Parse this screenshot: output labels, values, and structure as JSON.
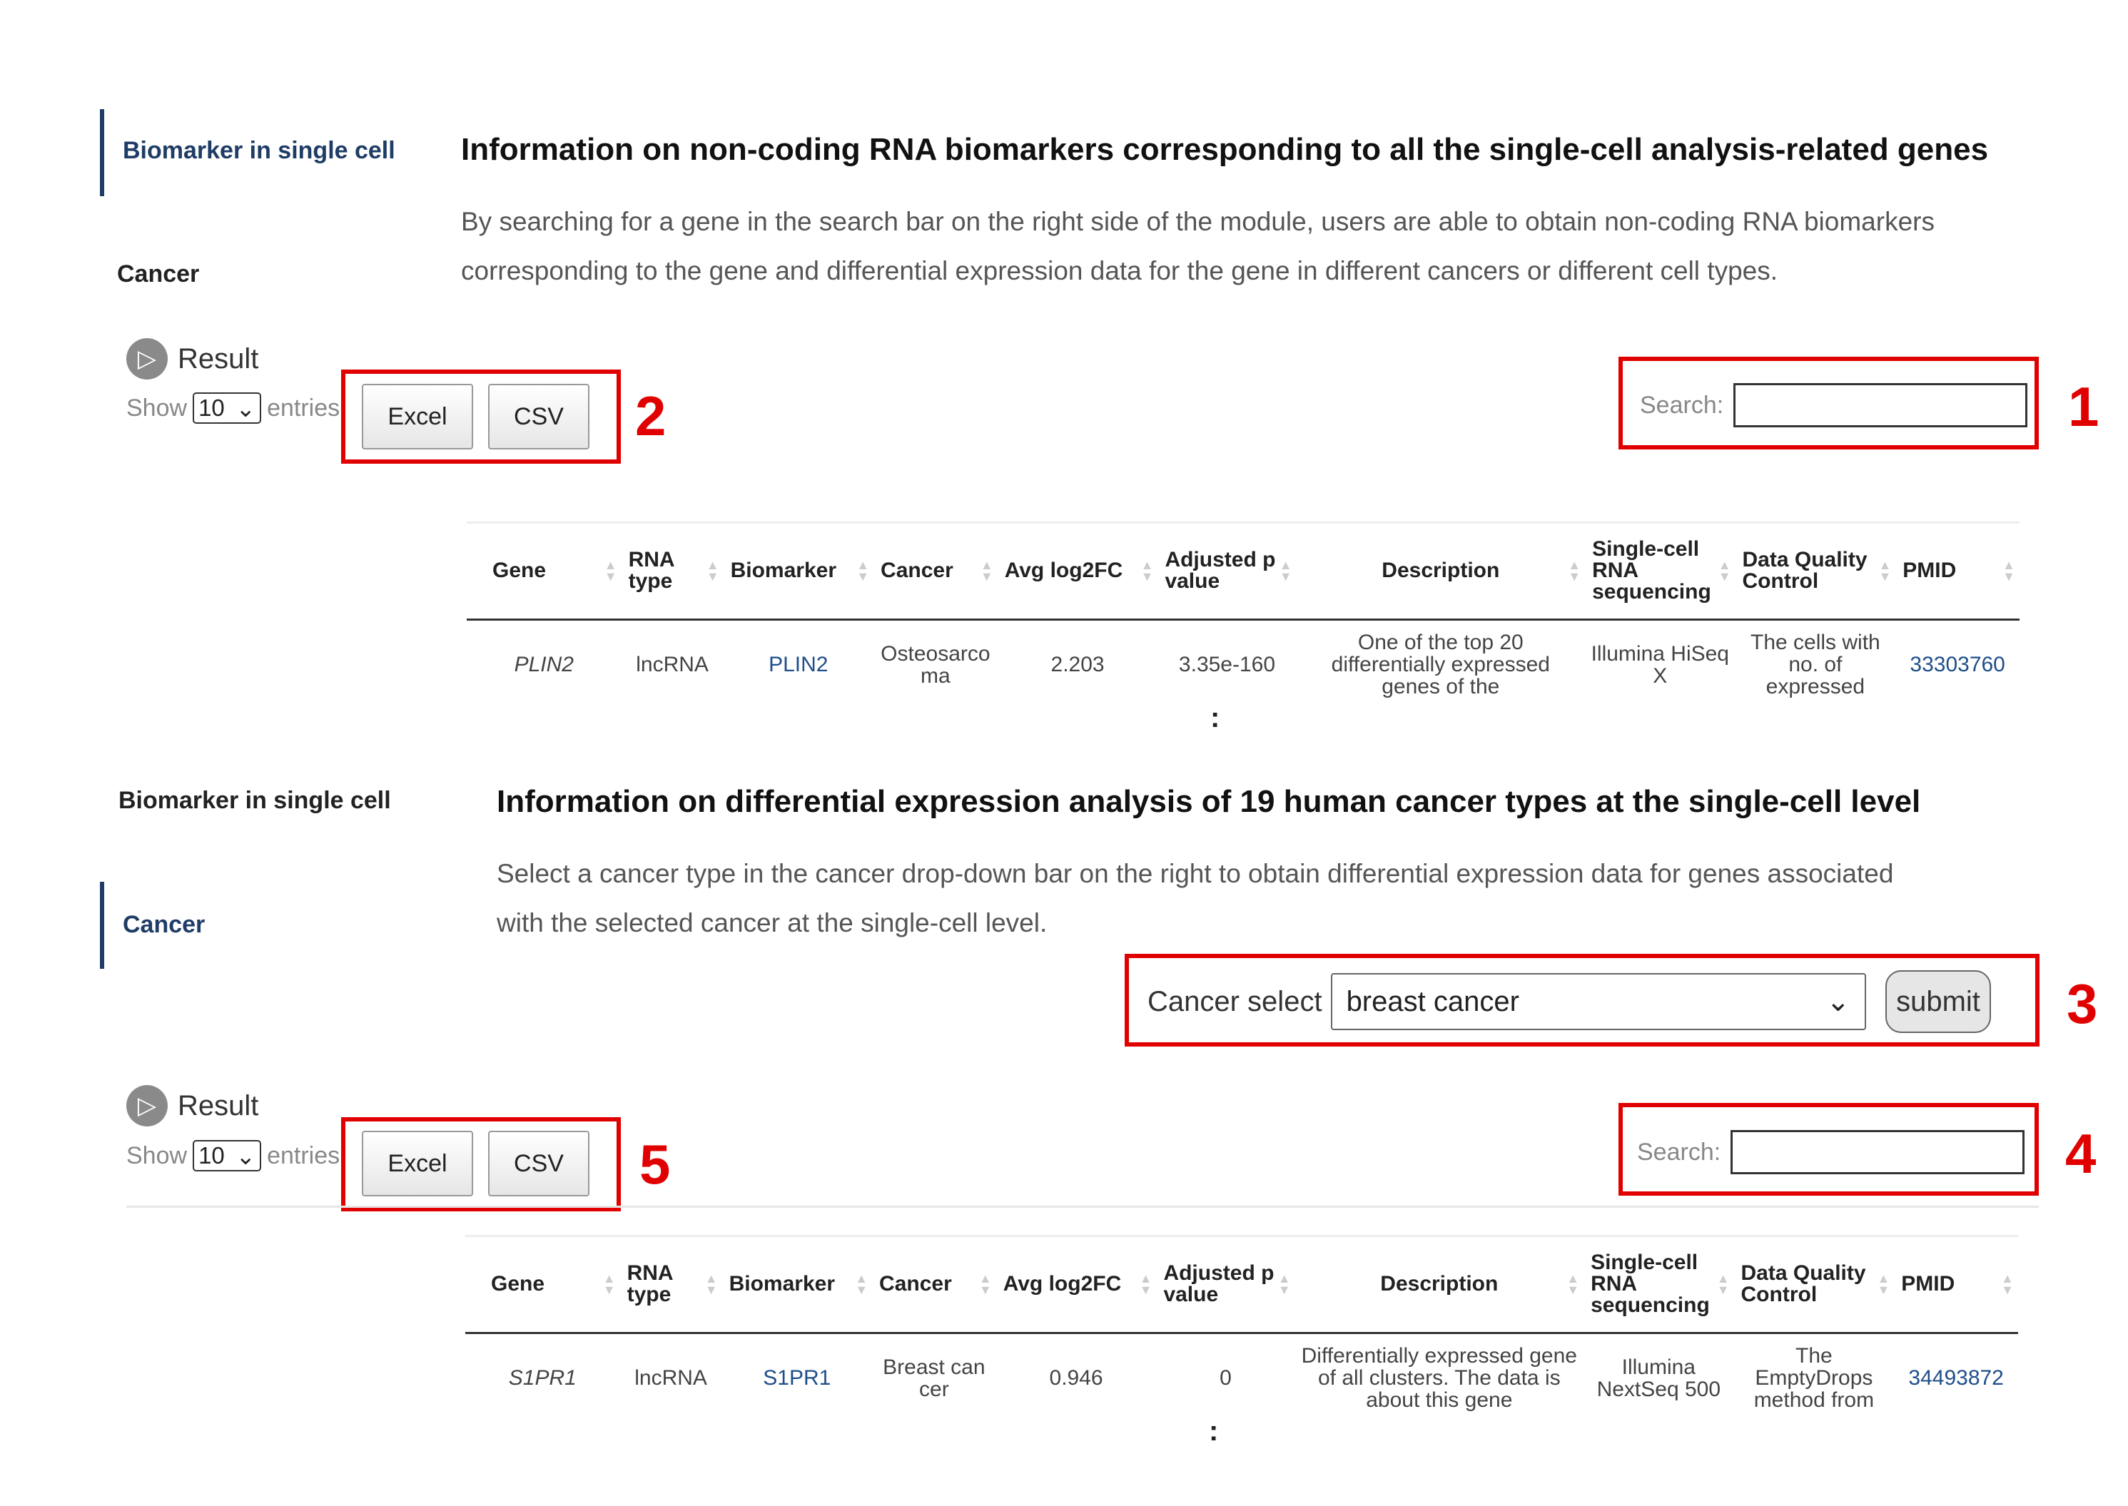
{
  "panel1": {
    "nav": {
      "item1": "Biomarker in single cell",
      "item2": "Cancer"
    },
    "title": "Information on non-coding RNA biomarkers corresponding to all the single-cell analysis-related genes",
    "desc_line1": "By searching for a gene in the search bar on the right side of the module, users are able to obtain non-coding RNA biomarkers",
    "desc_line2": "corresponding to the gene and differential expression data for the gene in different cancers or different cell types.",
    "result_label": "Result",
    "show_label": "Show",
    "entries_value": "10",
    "entries_label": "entries",
    "excel_label": "Excel",
    "csv_label": "CSV",
    "search_label": "Search:",
    "table": {
      "headers": [
        "Gene",
        "RNA type",
        "Biomarker",
        "Cancer",
        "Avg log2FC",
        "Adjusted p value",
        "Description",
        "Single-cell RNA sequencing",
        "Data Quality Control",
        "PMID"
      ],
      "row": {
        "gene": "PLIN2",
        "rna_type": "lncRNA",
        "biomarker": "PLIN2",
        "cancer": "Osteosarcoma",
        "avg_log2fc": "2.203",
        "adj_p": "3.35e-160",
        "description": "One of the top 20 differentially expressed genes of the",
        "sequencing": "Illumina HiSeq X",
        "quality": "The cells with no. of expressed",
        "pmid": "33303760"
      }
    },
    "more": ":"
  },
  "panel2": {
    "nav": {
      "item1": "Biomarker in single cell",
      "item2": "Cancer"
    },
    "title": "Information on differential expression analysis of 19 human cancer types at the single-cell level",
    "desc_line1": "Select a cancer type in the cancer drop-down bar on the right to obtain differential expression data for genes associated",
    "desc_line2": "with the selected cancer at the single-cell level.",
    "cancer_select_label": "Cancer select",
    "cancer_select_value": "breast cancer",
    "submit_label": "submit",
    "result_label": "Result",
    "show_label": "Show",
    "entries_value": "10",
    "entries_label": "entries",
    "excel_label": "Excel",
    "csv_label": "CSV",
    "search_label": "Search:",
    "table": {
      "headers": [
        "Gene",
        "RNA type",
        "Biomarker",
        "Cancer",
        "Avg log2FC",
        "Adjusted p value",
        "Description",
        "Single-cell RNA sequencing",
        "Data Quality Control",
        "PMID"
      ],
      "row": {
        "gene": "S1PR1",
        "rna_type": "lncRNA",
        "biomarker": "S1PR1",
        "cancer": "Breast cancer",
        "avg_log2fc": "0.946",
        "adj_p": "0",
        "description": "Differentially expressed gene of all clusters. The data is about this gene",
        "sequencing": "Illumina NextSeq 500",
        "quality": "The EmptyDrops method from",
        "pmid": "34493872"
      }
    },
    "more": ":"
  },
  "annotations": [
    "1",
    "2",
    "3",
    "4",
    "5"
  ],
  "colors": {
    "annotation_red": "#e00000",
    "nav_accent": "#1f3c66",
    "link": "#1f4e8a"
  }
}
